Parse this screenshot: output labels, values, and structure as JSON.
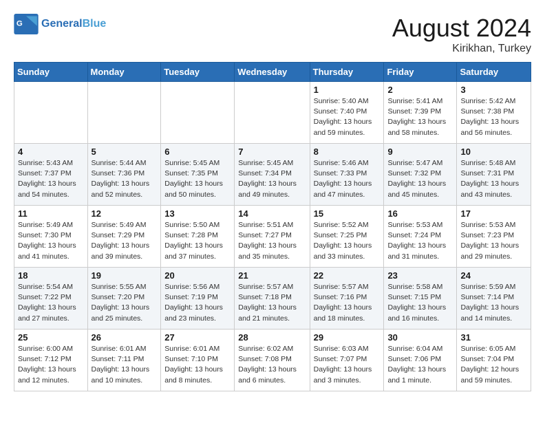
{
  "header": {
    "logo_general": "General",
    "logo_blue": "Blue",
    "month_title": "August 2024",
    "location": "Kirikhan, Turkey"
  },
  "weekdays": [
    "Sunday",
    "Monday",
    "Tuesday",
    "Wednesday",
    "Thursday",
    "Friday",
    "Saturday"
  ],
  "weeks": [
    [
      {
        "day": "",
        "sunrise": "",
        "sunset": "",
        "daylight": ""
      },
      {
        "day": "",
        "sunrise": "",
        "sunset": "",
        "daylight": ""
      },
      {
        "day": "",
        "sunrise": "",
        "sunset": "",
        "daylight": ""
      },
      {
        "day": "",
        "sunrise": "",
        "sunset": "",
        "daylight": ""
      },
      {
        "day": "1",
        "sunrise": "Sunrise: 5:40 AM",
        "sunset": "Sunset: 7:40 PM",
        "daylight": "Daylight: 13 hours and 59 minutes."
      },
      {
        "day": "2",
        "sunrise": "Sunrise: 5:41 AM",
        "sunset": "Sunset: 7:39 PM",
        "daylight": "Daylight: 13 hours and 58 minutes."
      },
      {
        "day": "3",
        "sunrise": "Sunrise: 5:42 AM",
        "sunset": "Sunset: 7:38 PM",
        "daylight": "Daylight: 13 hours and 56 minutes."
      }
    ],
    [
      {
        "day": "4",
        "sunrise": "Sunrise: 5:43 AM",
        "sunset": "Sunset: 7:37 PM",
        "daylight": "Daylight: 13 hours and 54 minutes."
      },
      {
        "day": "5",
        "sunrise": "Sunrise: 5:44 AM",
        "sunset": "Sunset: 7:36 PM",
        "daylight": "Daylight: 13 hours and 52 minutes."
      },
      {
        "day": "6",
        "sunrise": "Sunrise: 5:45 AM",
        "sunset": "Sunset: 7:35 PM",
        "daylight": "Daylight: 13 hours and 50 minutes."
      },
      {
        "day": "7",
        "sunrise": "Sunrise: 5:45 AM",
        "sunset": "Sunset: 7:34 PM",
        "daylight": "Daylight: 13 hours and 49 minutes."
      },
      {
        "day": "8",
        "sunrise": "Sunrise: 5:46 AM",
        "sunset": "Sunset: 7:33 PM",
        "daylight": "Daylight: 13 hours and 47 minutes."
      },
      {
        "day": "9",
        "sunrise": "Sunrise: 5:47 AM",
        "sunset": "Sunset: 7:32 PM",
        "daylight": "Daylight: 13 hours and 45 minutes."
      },
      {
        "day": "10",
        "sunrise": "Sunrise: 5:48 AM",
        "sunset": "Sunset: 7:31 PM",
        "daylight": "Daylight: 13 hours and 43 minutes."
      }
    ],
    [
      {
        "day": "11",
        "sunrise": "Sunrise: 5:49 AM",
        "sunset": "Sunset: 7:30 PM",
        "daylight": "Daylight: 13 hours and 41 minutes."
      },
      {
        "day": "12",
        "sunrise": "Sunrise: 5:49 AM",
        "sunset": "Sunset: 7:29 PM",
        "daylight": "Daylight: 13 hours and 39 minutes."
      },
      {
        "day": "13",
        "sunrise": "Sunrise: 5:50 AM",
        "sunset": "Sunset: 7:28 PM",
        "daylight": "Daylight: 13 hours and 37 minutes."
      },
      {
        "day": "14",
        "sunrise": "Sunrise: 5:51 AM",
        "sunset": "Sunset: 7:27 PM",
        "daylight": "Daylight: 13 hours and 35 minutes."
      },
      {
        "day": "15",
        "sunrise": "Sunrise: 5:52 AM",
        "sunset": "Sunset: 7:25 PM",
        "daylight": "Daylight: 13 hours and 33 minutes."
      },
      {
        "day": "16",
        "sunrise": "Sunrise: 5:53 AM",
        "sunset": "Sunset: 7:24 PM",
        "daylight": "Daylight: 13 hours and 31 minutes."
      },
      {
        "day": "17",
        "sunrise": "Sunrise: 5:53 AM",
        "sunset": "Sunset: 7:23 PM",
        "daylight": "Daylight: 13 hours and 29 minutes."
      }
    ],
    [
      {
        "day": "18",
        "sunrise": "Sunrise: 5:54 AM",
        "sunset": "Sunset: 7:22 PM",
        "daylight": "Daylight: 13 hours and 27 minutes."
      },
      {
        "day": "19",
        "sunrise": "Sunrise: 5:55 AM",
        "sunset": "Sunset: 7:20 PM",
        "daylight": "Daylight: 13 hours and 25 minutes."
      },
      {
        "day": "20",
        "sunrise": "Sunrise: 5:56 AM",
        "sunset": "Sunset: 7:19 PM",
        "daylight": "Daylight: 13 hours and 23 minutes."
      },
      {
        "day": "21",
        "sunrise": "Sunrise: 5:57 AM",
        "sunset": "Sunset: 7:18 PM",
        "daylight": "Daylight: 13 hours and 21 minutes."
      },
      {
        "day": "22",
        "sunrise": "Sunrise: 5:57 AM",
        "sunset": "Sunset: 7:16 PM",
        "daylight": "Daylight: 13 hours and 18 minutes."
      },
      {
        "day": "23",
        "sunrise": "Sunrise: 5:58 AM",
        "sunset": "Sunset: 7:15 PM",
        "daylight": "Daylight: 13 hours and 16 minutes."
      },
      {
        "day": "24",
        "sunrise": "Sunrise: 5:59 AM",
        "sunset": "Sunset: 7:14 PM",
        "daylight": "Daylight: 13 hours and 14 minutes."
      }
    ],
    [
      {
        "day": "25",
        "sunrise": "Sunrise: 6:00 AM",
        "sunset": "Sunset: 7:12 PM",
        "daylight": "Daylight: 13 hours and 12 minutes."
      },
      {
        "day": "26",
        "sunrise": "Sunrise: 6:01 AM",
        "sunset": "Sunset: 7:11 PM",
        "daylight": "Daylight: 13 hours and 10 minutes."
      },
      {
        "day": "27",
        "sunrise": "Sunrise: 6:01 AM",
        "sunset": "Sunset: 7:10 PM",
        "daylight": "Daylight: 13 hours and 8 minutes."
      },
      {
        "day": "28",
        "sunrise": "Sunrise: 6:02 AM",
        "sunset": "Sunset: 7:08 PM",
        "daylight": "Daylight: 13 hours and 6 minutes."
      },
      {
        "day": "29",
        "sunrise": "Sunrise: 6:03 AM",
        "sunset": "Sunset: 7:07 PM",
        "daylight": "Daylight: 13 hours and 3 minutes."
      },
      {
        "day": "30",
        "sunrise": "Sunrise: 6:04 AM",
        "sunset": "Sunset: 7:06 PM",
        "daylight": "Daylight: 13 hours and 1 minute."
      },
      {
        "day": "31",
        "sunrise": "Sunrise: 6:05 AM",
        "sunset": "Sunset: 7:04 PM",
        "daylight": "Daylight: 12 hours and 59 minutes."
      }
    ]
  ]
}
